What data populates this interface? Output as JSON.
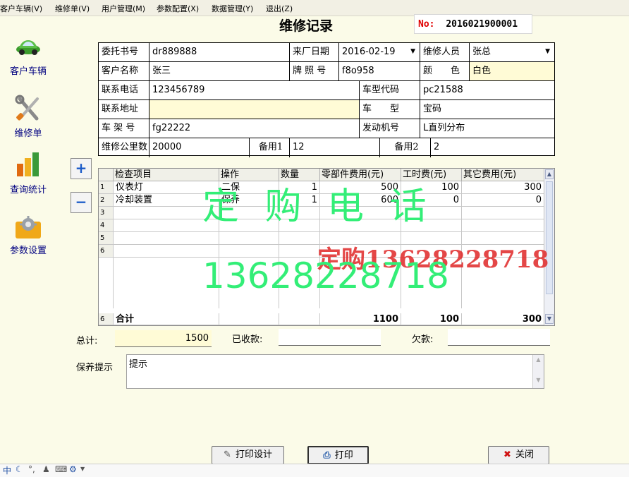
{
  "menu": [
    "客户车辆(V)",
    "维修单(V)",
    "用户管理(M)",
    "参数配置(X)",
    "数据管理(Y)",
    "退出(Z)"
  ],
  "sidebar": [
    {
      "label": "客户车辆",
      "icon": "car-icon"
    },
    {
      "label": "维修单",
      "icon": "tools-icon"
    },
    {
      "label": "查询统计",
      "icon": "bar-chart-icon"
    },
    {
      "label": "参数设置",
      "icon": "gear-icon"
    }
  ],
  "title": "维修记录",
  "record_no": {
    "prefix": "No:",
    "value": "2016021900001"
  },
  "form": {
    "entrust_label": "委托书号",
    "entrust_value": "dr889888",
    "date_label": "来厂日期",
    "date_value": "2016-02-19",
    "staff_label": "维修人员",
    "staff_value": "张总",
    "customer_label": "客户名称",
    "customer_value": "张三",
    "plate_label": "牌 照 号",
    "plate_value": "f8o958",
    "color_label": "颜　　色",
    "color_value": "白色",
    "phone_label": "联系电话",
    "phone_value": "123456789",
    "modelcode_label": "车型代码",
    "modelcode_value": "pc21588",
    "address_label": "联系地址",
    "address_value": "",
    "model_label": "车　　型",
    "model_value": "宝码",
    "frame_label": "车 架 号",
    "frame_value": "fg22222",
    "engine_label": "发动机号",
    "engine_value": "L直列分布",
    "mileage_label": "维修公里数",
    "mileage_value": "20000",
    "spare1_label": "备用1",
    "spare1_value": "12",
    "spare2_label": "备用2",
    "spare2_value": "2"
  },
  "grid": {
    "headers": [
      "检查项目",
      "操作",
      "数量",
      "零部件费用(元)",
      "工时费(元)",
      "其它费用(元)"
    ],
    "rows": [
      {
        "n": "1",
        "item": "仪表灯",
        "op": "二保",
        "qty": "1",
        "parts": "500",
        "labor": "100",
        "other": "300"
      },
      {
        "n": "2",
        "item": "冷却装置",
        "op": "保养",
        "qty": "1",
        "parts": "600",
        "labor": "0",
        "other": "0"
      },
      {
        "n": "3",
        "item": "",
        "op": "",
        "qty": "",
        "parts": "",
        "labor": "",
        "other": ""
      },
      {
        "n": "4",
        "item": "",
        "op": "",
        "qty": "",
        "parts": "",
        "labor": "",
        "other": ""
      },
      {
        "n": "5",
        "item": "",
        "op": "",
        "qty": "",
        "parts": "",
        "labor": "",
        "other": ""
      },
      {
        "n": "6",
        "item": "",
        "op": "",
        "qty": "",
        "parts": "",
        "labor": "",
        "other": ""
      }
    ],
    "total": {
      "n": "6",
      "label": "合计",
      "parts": "1100",
      "labor": "100",
      "other": "300"
    }
  },
  "summary": {
    "total_label": "总计:",
    "total_value": "1500",
    "received_label": "已收款:",
    "received_value": "",
    "owed_label": "欠款:",
    "owed_value": ""
  },
  "tip": {
    "label": "保养提示",
    "value": "提示"
  },
  "buttons": {
    "print_design": "打印设计",
    "print": "打印",
    "close": "关闭"
  },
  "watermark": {
    "line1": "定 购 电 话",
    "line2": "定购13628228718",
    "line3": "13628228718"
  },
  "taskbar": {
    "ime": "中"
  }
}
